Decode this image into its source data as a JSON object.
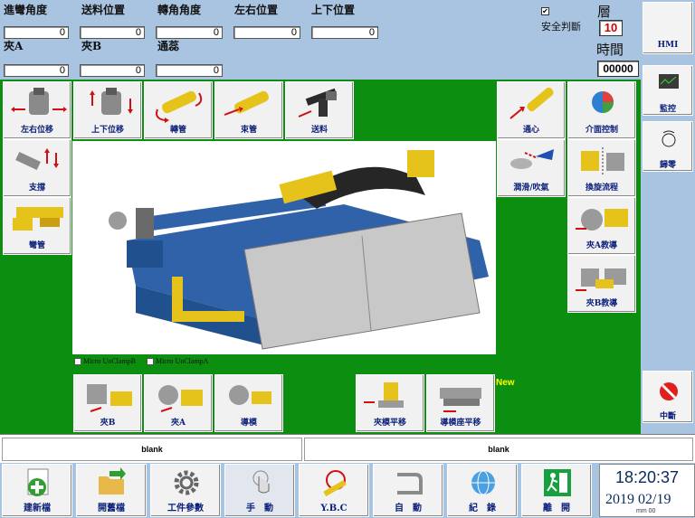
{
  "params": {
    "row1": [
      {
        "label": "進彎角度",
        "value": "0"
      },
      {
        "label": "送料位置",
        "value": "0"
      },
      {
        "label": "轉角角度",
        "value": "0"
      },
      {
        "label": "左右位置",
        "value": "0"
      },
      {
        "label": "上下位置",
        "value": "0"
      }
    ],
    "row2": [
      {
        "label": "夾A",
        "value": "0"
      },
      {
        "label": "夾B",
        "value": "0"
      },
      {
        "label": "通蕊",
        "value": "0"
      }
    ]
  },
  "safety": {
    "checked": "✔",
    "label": "安全判斷"
  },
  "layer": {
    "label": "層",
    "value": "10"
  },
  "time": {
    "label": "時間",
    "value": "00000"
  },
  "tiles": {
    "lr_shift": "左右位移",
    "ud_shift": "上下位移",
    "rotate_tube": "轉管",
    "bundle_tube": "束管",
    "feed": "送料",
    "support": "支撐",
    "bend_tube": "彎管",
    "center": "通心",
    "interface_control": "介面控制",
    "lube_blow": "潤滑/吹氣",
    "switch_flow": "換旋流程",
    "clamp_a_teach": "夾A教導",
    "clamp_b_teach": "夾B教導",
    "clamp_b": "夾B",
    "clamp_a": "夾A",
    "guide_die": "導模",
    "clamp_die_shift": "夾模平移",
    "guide_seat_shift": "導模座平移"
  },
  "clamp_options": {
    "b": "Micro UnClampB",
    "a": "Micro UnClampA"
  },
  "new_label": "New",
  "side": {
    "hmi": "HMI",
    "monitor": "監控",
    "zero": "歸零",
    "interrupt": "中斷"
  },
  "status": {
    "left": "blank",
    "right": "blank"
  },
  "toolbar": {
    "new_file": "建新檔",
    "open_file": "開舊檔",
    "work_params": "工件參數",
    "manual": "手　動",
    "ybc": "Y.B.C",
    "auto": "自　動",
    "record": "紀　錄",
    "exit": "離　開"
  },
  "clock": {
    "time": "18:20:37",
    "date": "2019 02/19",
    "units": "mm    00"
  },
  "colors": {
    "panel_green": "#0c8f10",
    "frame_blue": "#a9c4e0",
    "label_navy": "#0a1f7a",
    "layer_red": "#d00000"
  }
}
